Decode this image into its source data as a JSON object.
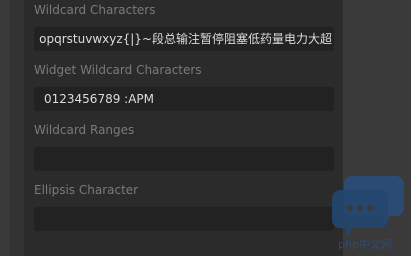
{
  "fields": [
    {
      "label": "Wildcard Characters",
      "value": "opqrstuvwxyz{|}~段总输注暂停阻塞低药量电力大超"
    },
    {
      "label": "Widget Wildcard Characters",
      "value": "0123456789 :APM"
    },
    {
      "label": "Wildcard Ranges",
      "value": ""
    },
    {
      "label": "Ellipsis Character",
      "value": ""
    }
  ],
  "watermark": {
    "text": "php中文网"
  }
}
